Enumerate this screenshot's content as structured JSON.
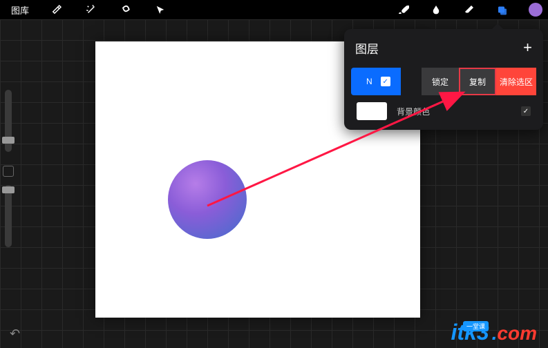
{
  "toolbar": {
    "gallery": "图库"
  },
  "layers": {
    "title": "图层",
    "blend_mode": "N",
    "actions": {
      "lock": "锁定",
      "copy": "复制",
      "clear": "清除选区"
    },
    "background_label": "背景颜色"
  },
  "watermark": {
    "brand": "itk3",
    "tld": "com",
    "tagline": "一堂课"
  },
  "colors": {
    "accent": "#0a6cff",
    "danger": "#ff453a",
    "highlight": "#e63946",
    "brand": "#9b6dd7"
  }
}
